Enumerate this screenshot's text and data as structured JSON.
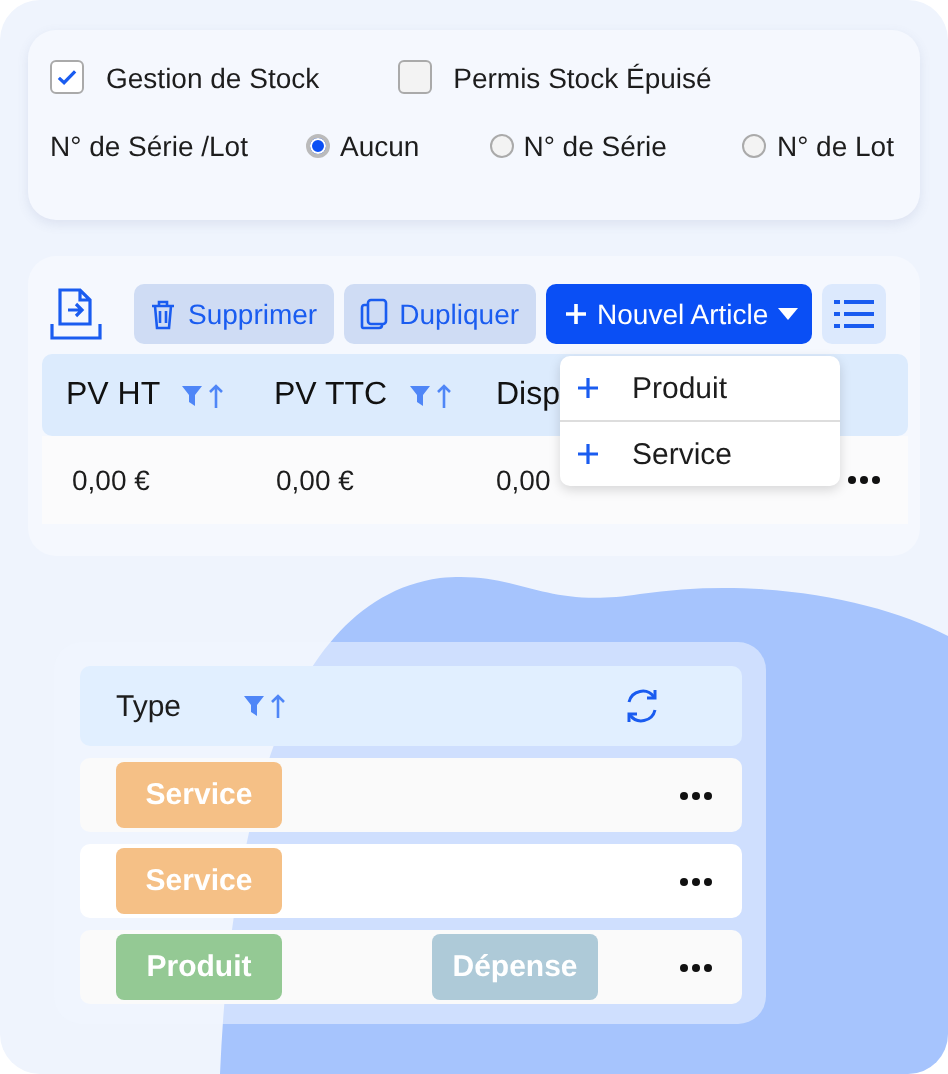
{
  "settings": {
    "checkboxes": [
      {
        "label": "Gestion de Stock",
        "checked": true
      },
      {
        "label": "Permis Stock Épuisé",
        "checked": false
      }
    ],
    "serial_label": "N° de Série /Lot",
    "radios": [
      {
        "label": "Aucun",
        "selected": true
      },
      {
        "label": "N° de Série",
        "selected": false
      },
      {
        "label": "N° de Lot",
        "selected": false
      }
    ]
  },
  "toolbar": {
    "delete": "Supprimer",
    "duplicate": "Dupliquer",
    "new_article": "Nouvel Article"
  },
  "new_menu": {
    "items": [
      "Produit",
      "Service"
    ]
  },
  "table": {
    "columns": [
      {
        "label": "PV HT",
        "filter": true
      },
      {
        "label": "PV TTC",
        "filter": true
      },
      {
        "label": "Disp"
      }
    ],
    "rows": [
      [
        "0,00 €",
        "0,00 €",
        "0,00"
      ]
    ]
  },
  "types": {
    "header": "Type",
    "rows": [
      {
        "tags": [
          {
            "label": "Service",
            "color": "#f5c086"
          }
        ]
      },
      {
        "tags": [
          {
            "label": "Service",
            "color": "#f5c086"
          }
        ]
      },
      {
        "tags": [
          {
            "label": "Produit",
            "color": "#94c994"
          },
          {
            "label": "Dépense",
            "color": "#aecad8"
          }
        ]
      }
    ]
  }
}
